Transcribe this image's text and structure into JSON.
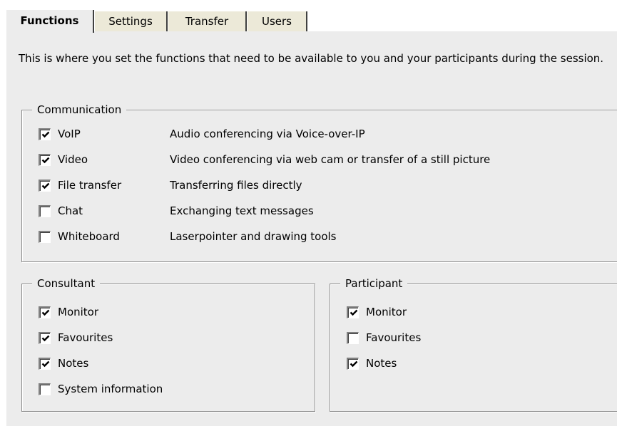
{
  "tabs": [
    {
      "label": "Functions",
      "active": true
    },
    {
      "label": "Settings",
      "active": false
    },
    {
      "label": "Transfer",
      "active": false
    },
    {
      "label": "Users",
      "active": false
    }
  ],
  "intro_text": "This is where you set the functions that need to be available to you and your participants during the session.",
  "communication": {
    "title": "Communication",
    "items": [
      {
        "label": "VoIP",
        "checked": true,
        "description": "Audio conferencing via Voice-over-IP"
      },
      {
        "label": "Video",
        "checked": true,
        "description": "Video conferencing via web cam or transfer of a still picture"
      },
      {
        "label": "File transfer",
        "checked": true,
        "description": "Transferring files directly"
      },
      {
        "label": "Chat",
        "checked": false,
        "description": "Exchanging text messages"
      },
      {
        "label": "Whiteboard",
        "checked": false,
        "description": "Laserpointer and drawing tools"
      }
    ]
  },
  "consultant": {
    "title": "Consultant",
    "items": [
      {
        "label": "Monitor",
        "checked": true
      },
      {
        "label": "Favourites",
        "checked": true
      },
      {
        "label": "Notes",
        "checked": true
      },
      {
        "label": "System information",
        "checked": false
      }
    ]
  },
  "participant": {
    "title": "Participant",
    "items": [
      {
        "label": "Monitor",
        "checked": true
      },
      {
        "label": "Favourites",
        "checked": false
      },
      {
        "label": "Notes",
        "checked": true
      }
    ]
  },
  "colors": {
    "panel_background": "#ececec",
    "group_border": "#8c8c8c",
    "tab_border_dark": "#404040"
  },
  "icons": {
    "checked": "checkmark-icon"
  }
}
